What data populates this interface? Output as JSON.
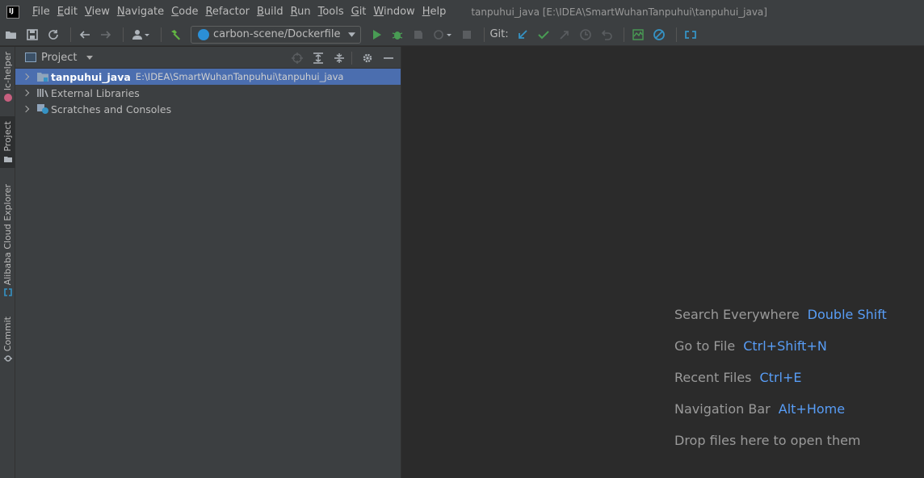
{
  "menubar": {
    "items": [
      {
        "mnemonic": "F",
        "rest": "ile"
      },
      {
        "mnemonic": "E",
        "rest": "dit"
      },
      {
        "mnemonic": "V",
        "rest": "iew"
      },
      {
        "mnemonic": "N",
        "rest": "avigate"
      },
      {
        "mnemonic": "C",
        "rest": "ode"
      },
      {
        "mnemonic": "R",
        "rest": "efactor"
      },
      {
        "mnemonic": "B",
        "rest": "uild"
      },
      {
        "mnemonic": "R",
        "rest": "un",
        "pre": ""
      },
      {
        "mnemonic": "T",
        "rest": "ools"
      },
      {
        "mnemonic": "G",
        "rest": "it"
      },
      {
        "mnemonic": "W",
        "rest": "indow"
      },
      {
        "mnemonic": "H",
        "rest": "elp"
      }
    ],
    "window_title": "tanpuhui_java [E:\\IDEA\\SmartWuhanTanpuhui\\tanpuhui_java]"
  },
  "toolbar": {
    "run_config": "carbon-scene/Dockerfile",
    "git_label": "Git:"
  },
  "left_strip": {
    "tabs": [
      "lc-helper",
      "Project",
      "Alibaba Cloud Explorer",
      "Commit"
    ]
  },
  "project_panel": {
    "title": "Project",
    "tree": [
      {
        "name": "tanpuhui_java",
        "path": "E:\\IDEA\\SmartWuhanTanpuhui\\tanpuhui_java",
        "selected": true
      },
      {
        "name": "External Libraries",
        "path": ""
      },
      {
        "name": "Scratches and Consoles",
        "path": ""
      }
    ]
  },
  "editor": {
    "hints": [
      {
        "text": "Search Everywhere",
        "key": "Double Shift"
      },
      {
        "text": "Go to File",
        "key": "Ctrl+Shift+N"
      },
      {
        "text": "Recent Files",
        "key": "Ctrl+E"
      },
      {
        "text": "Navigation Bar",
        "key": "Alt+Home"
      },
      {
        "text": "Drop files here to open them",
        "key": ""
      }
    ]
  },
  "colors": {
    "accent": "#589df6",
    "selection": "#4b6eaf",
    "panel_bg": "#3c3f41",
    "editor_bg": "#2b2b2b"
  }
}
